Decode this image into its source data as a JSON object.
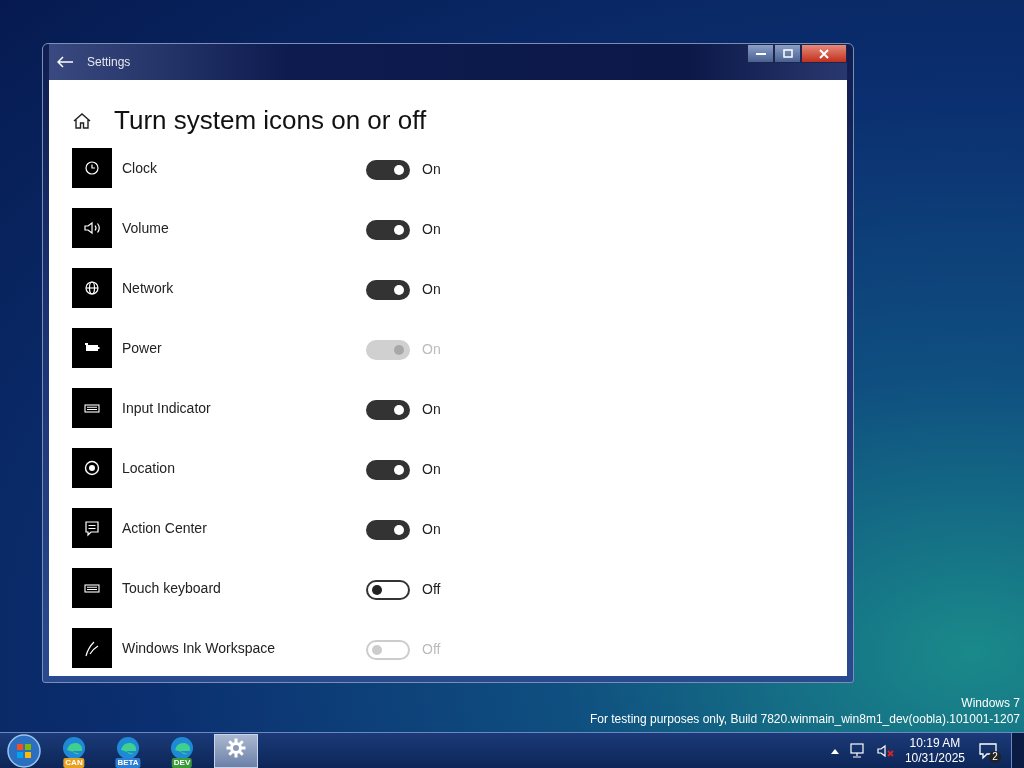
{
  "window": {
    "title": "Settings"
  },
  "page": {
    "heading": "Turn system icons on or off"
  },
  "items": [
    {
      "name": "Clock",
      "on": true,
      "disabled": false,
      "state_label": "On"
    },
    {
      "name": "Volume",
      "on": true,
      "disabled": false,
      "state_label": "On"
    },
    {
      "name": "Network",
      "on": true,
      "disabled": false,
      "state_label": "On"
    },
    {
      "name": "Power",
      "on": true,
      "disabled": true,
      "state_label": "On"
    },
    {
      "name": "Input Indicator",
      "on": true,
      "disabled": false,
      "state_label": "On"
    },
    {
      "name": "Location",
      "on": true,
      "disabled": false,
      "state_label": "On"
    },
    {
      "name": "Action Center",
      "on": true,
      "disabled": false,
      "state_label": "On"
    },
    {
      "name": "Touch keyboard",
      "on": false,
      "disabled": false,
      "state_label": "Off"
    },
    {
      "name": "Windows Ink Workspace",
      "on": false,
      "disabled": true,
      "state_label": "Off"
    }
  ],
  "desktop": {
    "edition": "Windows 7",
    "build": "For testing purposes only, Build 7820.winmain_win8m1_dev(oobla).101001-1207"
  },
  "taskbar": {
    "apps": [
      {
        "kind": "browser",
        "badge": "CAN",
        "color": "#e8a020",
        "selected": false
      },
      {
        "kind": "browser",
        "badge": "BETA",
        "color": "#2a7fd4",
        "selected": false
      },
      {
        "kind": "browser",
        "badge": "DEV",
        "color": "#3a9a3a",
        "selected": false
      },
      {
        "kind": "settings",
        "selected": true
      }
    ],
    "time": "10:19 AM",
    "date": "10/31/2025",
    "notifications": "2"
  }
}
